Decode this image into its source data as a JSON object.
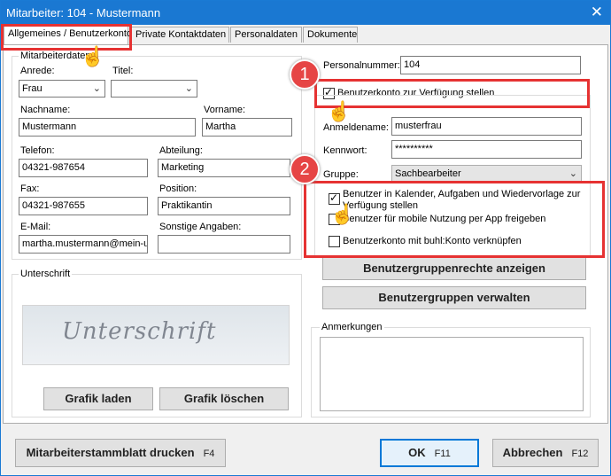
{
  "window": {
    "title": "Mitarbeiter: 104 - Mustermann",
    "close_symbol": "✕"
  },
  "tabs": [
    {
      "label": "Allgemeines / Benutzerkonto",
      "active": true
    },
    {
      "label": "Private Kontaktdaten",
      "active": false
    },
    {
      "label": "Personaldaten",
      "active": false
    },
    {
      "label": "Dokumente",
      "active": false
    }
  ],
  "employee": {
    "group_label": "Mitarbeiterdaten",
    "anrede": {
      "label": "Anrede:",
      "value": "Frau"
    },
    "titel": {
      "label": "Titel:",
      "value": ""
    },
    "nachname": {
      "label": "Nachname:",
      "value": "Mustermann"
    },
    "vorname": {
      "label": "Vorname:",
      "value": "Martha"
    },
    "telefon": {
      "label": "Telefon:",
      "value": "04321-987654"
    },
    "abteilung": {
      "label": "Abteilung:",
      "value": "Marketing"
    },
    "fax": {
      "label": "Fax:",
      "value": "04321-987655"
    },
    "position": {
      "label": "Position:",
      "value": "Praktikantin"
    },
    "email": {
      "label": "E-Mail:",
      "value": "martha.mustermann@mein-u"
    },
    "sonstige": {
      "label": "Sonstige Angaben:",
      "value": ""
    }
  },
  "signature": {
    "group_label": "Unterschrift",
    "image_text": "Unterschrift",
    "load_button": "Grafik laden",
    "delete_button": "Grafik löschen"
  },
  "account": {
    "personalnummer": {
      "label": "Personalnummer:",
      "value": "104"
    },
    "enable_account": {
      "label": "Benutzerkonto zur Verfügung stellen",
      "checked": true
    },
    "username": {
      "label": "Anmeldename:",
      "value": "musterfrau"
    },
    "password": {
      "label": "Kennwort:",
      "value": "**********"
    },
    "group": {
      "label": "Gruppe:",
      "value": "Sachbearbeiter"
    },
    "options": [
      {
        "label": "Benutzer in Kalender, Aufgaben und Wiedervorlage zur Verfügung stellen",
        "checked": true
      },
      {
        "label": "Benutzer für mobile Nutzung per App freigeben",
        "checked": false
      },
      {
        "label": "Benutzerkonto mit buhl:Konto verknüpfen",
        "checked": false
      }
    ],
    "rights_button": "Benutzergruppenrechte anzeigen",
    "manage_button": "Benutzergruppen verwalten"
  },
  "notes": {
    "label": "Anmerkungen",
    "value": ""
  },
  "footer": {
    "print_button": "Mitarbeiterstammblatt drucken",
    "print_key": "F4",
    "ok_button": "OK",
    "ok_key": "F11",
    "cancel_button": "Abbrechen",
    "cancel_key": "F12"
  },
  "annotations": {
    "marker_1": "1",
    "marker_2": "2"
  },
  "colors": {
    "title_bar": "#1a78d2",
    "highlight": "#e63232",
    "primary_border": "#0078d7"
  }
}
